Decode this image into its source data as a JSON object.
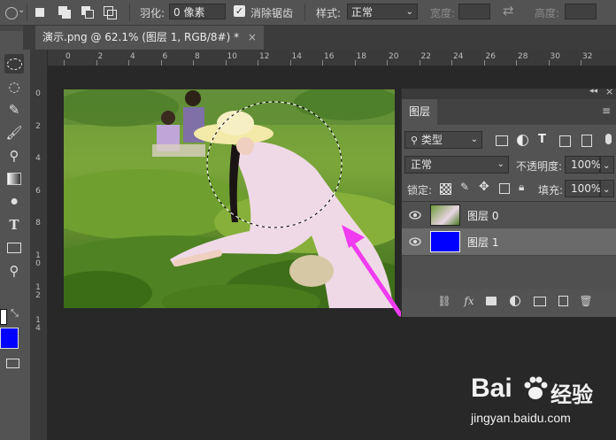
{
  "options_bar": {
    "feather_label": "羽化:",
    "feather_value": "0 像素",
    "antialias_label": "消除锯齿",
    "style_label": "样式:",
    "style_value": "正常",
    "width_label": "宽度:",
    "height_label": "高度:"
  },
  "document_tab": {
    "title": "演示.png @ 62.1% (图层 1, RGB/8#) *",
    "close": "×"
  },
  "ruler": {
    "top_ticks": [
      "0",
      "2",
      "4",
      "6",
      "8",
      "10",
      "12",
      "14",
      "16",
      "18",
      "20",
      "22",
      "24",
      "26",
      "28",
      "30",
      "32"
    ],
    "left_ticks": [
      "0",
      "2",
      "4",
      "6",
      "8",
      "1 0",
      "1 2",
      "1 4"
    ]
  },
  "colors": {
    "foreground": "#ffffff",
    "background": "#0000ff",
    "layer1_fill": "#0000ff"
  },
  "layers_panel": {
    "tab_label": "图层",
    "collapse": "◂◂",
    "close": "×",
    "filter_label": "类型",
    "blend_mode": "正常",
    "opacity_label": "不透明度:",
    "opacity_value": "100%",
    "lock_label": "锁定:",
    "fill_label": "填充:",
    "fill_value": "100%",
    "layers": [
      {
        "name": "图层 0"
      },
      {
        "name": "图层 1"
      }
    ]
  },
  "watermark": {
    "brand": "Bai",
    "brand_cn": "经验",
    "url": "jingyan.baidu.com"
  }
}
